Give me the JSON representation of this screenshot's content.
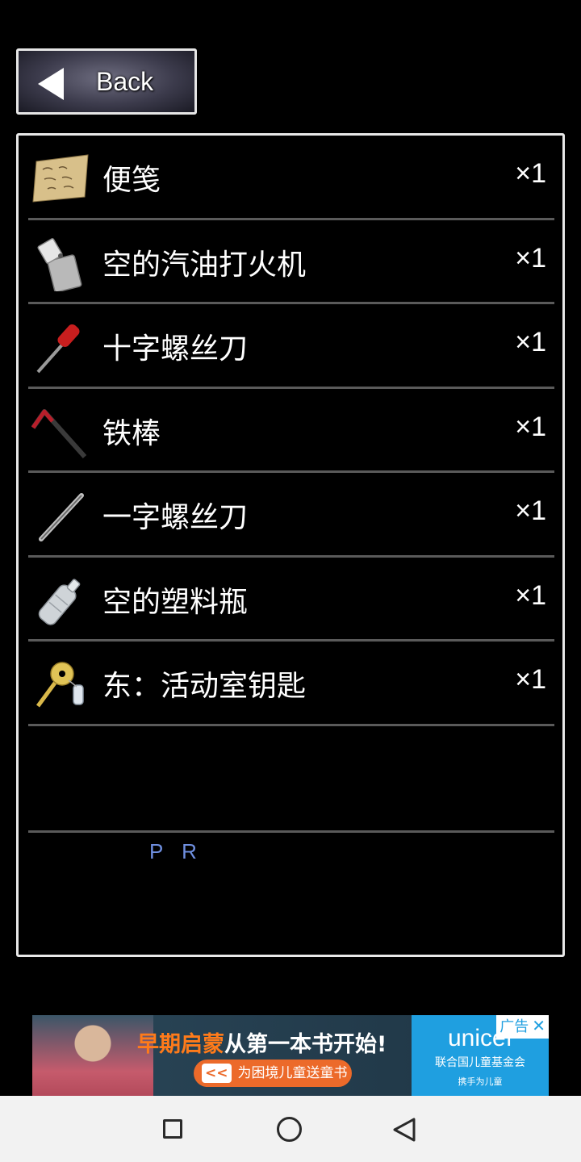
{
  "back_button": {
    "label": "Back"
  },
  "inventory": {
    "items": [
      {
        "name": "便笺",
        "qty": "×1",
        "icon": "note-paper-icon"
      },
      {
        "name": "空的汽油打火机",
        "qty": "×1",
        "icon": "lighter-icon"
      },
      {
        "name": "十字螺丝刀",
        "qty": "×1",
        "icon": "phillips-screwdriver-icon"
      },
      {
        "name": "铁棒",
        "qty": "×1",
        "icon": "iron-bar-icon"
      },
      {
        "name": "一字螺丝刀",
        "qty": "×1",
        "icon": "flathead-screwdriver-icon"
      },
      {
        "name": "空的塑料瓶",
        "qty": "×1",
        "icon": "plastic-bottle-icon"
      },
      {
        "name": "东：活动室钥匙",
        "qty": "×1",
        "icon": "key-icon"
      }
    ],
    "pr_label": "P R"
  },
  "ad": {
    "headline_highlight": "早期启蒙",
    "headline_rest": "从第一本书开始!",
    "cta_chevron": "<<",
    "cta_label": "为困境儿童送童书",
    "brand_name": "unicef",
    "brand_sub": "联合国儿童基金会",
    "brand_tag": "携手为儿童",
    "badge_label": "广告",
    "badge_close": "✕"
  },
  "colors": {
    "background": "#000000",
    "panel_border": "#e8e8e8",
    "divider": "#5a5a5a",
    "pr_text": "#6f8fe0",
    "ad_highlight": "#ff7b1a",
    "ad_brand": "#1f9fe0",
    "navbar": "#f2f2f2"
  },
  "navbar": {
    "buttons": [
      "recent-apps-icon",
      "home-icon",
      "nav-back-icon"
    ]
  }
}
